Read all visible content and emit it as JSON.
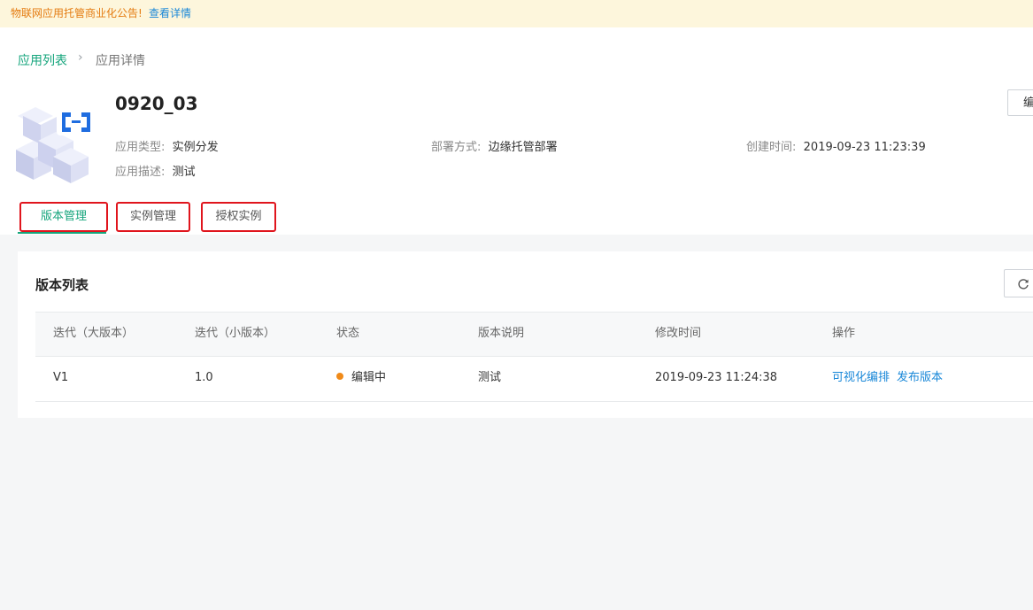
{
  "notice": {
    "text": "物联网应用托管商业化公告!",
    "link": "查看详情"
  },
  "breadcrumb": {
    "root": "应用列表",
    "separator": "›",
    "current": "应用详情"
  },
  "app": {
    "name": "0920_03",
    "type_label": "应用类型:",
    "type_value": "实例分发",
    "deploy_label": "部署方式:",
    "deploy_value": "边缘托管部署",
    "created_label": "创建时间:",
    "created_value": "2019-09-23 11:23:39",
    "desc_label": "应用描述:",
    "desc_value": "测试",
    "edit_button": "编"
  },
  "tabs": [
    {
      "label": "版本管理",
      "active": true
    },
    {
      "label": "实例管理",
      "active": false
    },
    {
      "label": "授权实例",
      "active": false
    }
  ],
  "version_list": {
    "title": "版本列表",
    "columns": [
      "迭代（大版本）",
      "迭代（小版本）",
      "状态",
      "版本说明",
      "修改时间",
      "操作"
    ],
    "rows": [
      {
        "major": "V1",
        "minor": "1.0",
        "status": "编辑中",
        "description": "测试",
        "modified": "2019-09-23 11:24:38",
        "actions": [
          "可视化编排",
          "发布版本"
        ]
      }
    ]
  },
  "colors": {
    "accent": "#15a57c",
    "link": "#1a88d8",
    "status_editing": "#f08a19",
    "highlight_border": "#e0151d",
    "notice_bg": "#fdf6dc",
    "notice_text": "#e47b10"
  },
  "icons": [
    "app-cube-icon",
    "refresh-icon",
    "status-dot-icon"
  ]
}
